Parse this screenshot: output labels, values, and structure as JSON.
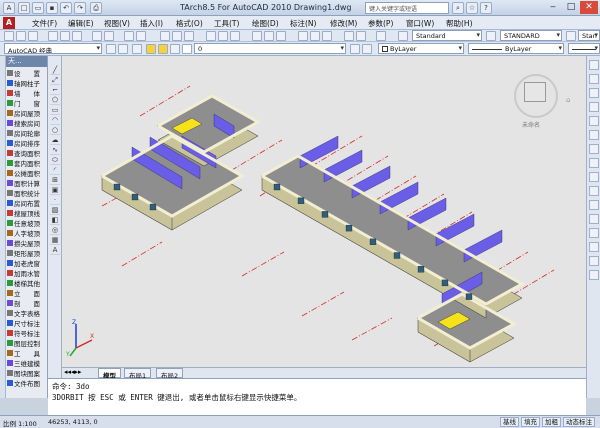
{
  "titlebar": {
    "title": "TArch8.5 For AutoCAD 2010    Drawing1.dwg",
    "search_placeholder": "键入关键字或短语"
  },
  "menu": [
    "文件(F)",
    "编辑(E)",
    "视图(V)",
    "插入(I)",
    "格式(O)",
    "工具(T)",
    "绘图(D)",
    "标注(N)",
    "修改(M)",
    "参数(P)",
    "窗口(W)",
    "帮助(H)"
  ],
  "toolbar": {
    "text_style": "Standard",
    "dim_style": "STANDARD",
    "table_style": "Stan",
    "workspace": "AutoCAD 经典",
    "layer": "0",
    "color": "ByLayer",
    "linetype": "ByLayer",
    "lineweight": "ByLayer"
  },
  "tpanel": {
    "title": "天...",
    "items": [
      "设　　置",
      "轴网柱子",
      "墙　　体",
      "门　　窗",
      "房间屋顶",
      "搜索房间",
      "房间轮廓",
      "房间排序",
      "查询面积",
      "套内面积",
      "公摊面积",
      "面积计算",
      "面积统计",
      "房间布置",
      "搜屋顶线",
      "任意坡顶",
      "人字坡顶",
      "攒尖屋顶",
      "矩形屋顶",
      "加老虎窗",
      "加雨水管",
      "楼梯其他",
      "立　　面",
      "剖　　面",
      "文字表格",
      "尺寸标注",
      "符号标注",
      "图层控制",
      "工　　具",
      "三维建模",
      "图块图案",
      "文件布图"
    ]
  },
  "viewcube": {
    "label": "未命名"
  },
  "tabs": [
    "模型",
    "布局1",
    "布局2"
  ],
  "command": {
    "line1": "命令: 3do",
    "line2": "3DORBIT 按 ESC 或 ENTER 键退出, 或者单击鼠标右键显示快捷菜单。"
  },
  "status": {
    "scale": "比例 1:100",
    "coords": "46253, 4113, 0",
    "buttons": [
      "基线",
      "填充",
      "加粗",
      "动态标注"
    ]
  },
  "colors": {
    "wall_top": "#f2eed2",
    "wall_side": "#c9c39a",
    "room_floor": "#8e8e8e",
    "interior_wall": "#6a5ee6",
    "axis_line": "#d62a2a",
    "stair": "#f5e21a"
  }
}
